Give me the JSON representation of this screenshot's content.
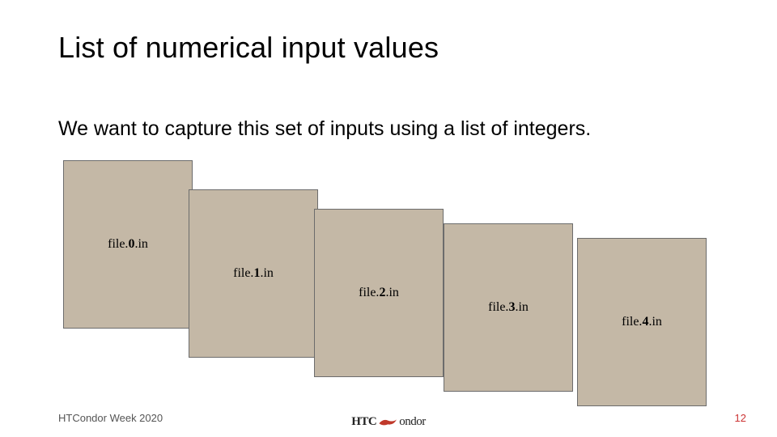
{
  "title": "List of numerical input values",
  "subtitle": "We want to capture this set of inputs using a list of integers.",
  "file_prefix": "file.",
  "file_suffix": ".in",
  "cards": [
    "0",
    "1",
    "2",
    "3",
    "4"
  ],
  "footer": {
    "left": "HTCondor Week 2020",
    "logo_part1": "HTC",
    "logo_part2": "ondor",
    "page": "12"
  }
}
